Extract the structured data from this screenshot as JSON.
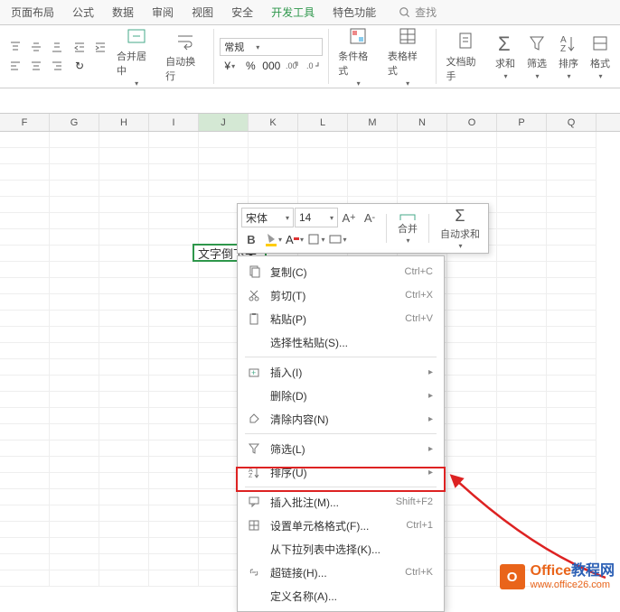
{
  "ribbon_tabs": [
    "页面布局",
    "公式",
    "数据",
    "审阅",
    "视图",
    "安全",
    "开发工具",
    "特色功能"
  ],
  "active_tab_index": 6,
  "search_label": "查找",
  "ribbon": {
    "merge_label": "合并居中",
    "wrap_label": "自动换行",
    "number_format": "常规",
    "cond_format": "条件格式",
    "table_style": "表格样式",
    "doc_helper": "文档助手",
    "sum": "求和",
    "filter": "筛选",
    "sort": "排序",
    "format": "格式",
    "symbols": {
      "percent": "%",
      "comma": "000"
    }
  },
  "columns": [
    "F",
    "G",
    "H",
    "I",
    "J",
    "K",
    "L",
    "M",
    "N",
    "O",
    "P",
    "Q"
  ],
  "selected_col": "J",
  "cell_text": "文字倒下来",
  "mini": {
    "font": "宋体",
    "size": "14",
    "merge": "合并",
    "autosum": "自动求和"
  },
  "menu": [
    {
      "icon": "copy",
      "label": "复制(C)",
      "shortcut": "Ctrl+C"
    },
    {
      "icon": "cut",
      "label": "剪切(T)",
      "shortcut": "Ctrl+X"
    },
    {
      "icon": "paste",
      "label": "粘贴(P)",
      "shortcut": "Ctrl+V"
    },
    {
      "icon": "",
      "label": "选择性粘贴(S)...",
      "shortcut": ""
    },
    {
      "sep": true
    },
    {
      "icon": "insert",
      "label": "插入(I)",
      "shortcut": "",
      "sub": true
    },
    {
      "icon": "",
      "label": "删除(D)",
      "shortcut": "",
      "sub": true
    },
    {
      "icon": "clear",
      "label": "清除内容(N)",
      "shortcut": "",
      "sub": true
    },
    {
      "sep": true
    },
    {
      "icon": "filter",
      "label": "筛选(L)",
      "shortcut": "",
      "sub": true
    },
    {
      "icon": "sort",
      "label": "排序(U)",
      "shortcut": "",
      "sub": true
    },
    {
      "sep": true
    },
    {
      "icon": "comment",
      "label": "插入批注(M)...",
      "shortcut": "Shift+F2"
    },
    {
      "icon": "format",
      "label": "设置单元格格式(F)...",
      "shortcut": "Ctrl+1",
      "hl": true
    },
    {
      "icon": "",
      "label": "从下拉列表中选择(K)...",
      "shortcut": ""
    },
    {
      "icon": "link",
      "label": "超链接(H)...",
      "shortcut": "Ctrl+K"
    },
    {
      "icon": "",
      "label": "定义名称(A)...",
      "shortcut": ""
    }
  ],
  "watermark": {
    "brand": "Office",
    "suffix": "教程网",
    "url": "www.office26.com",
    "logo": "O"
  }
}
